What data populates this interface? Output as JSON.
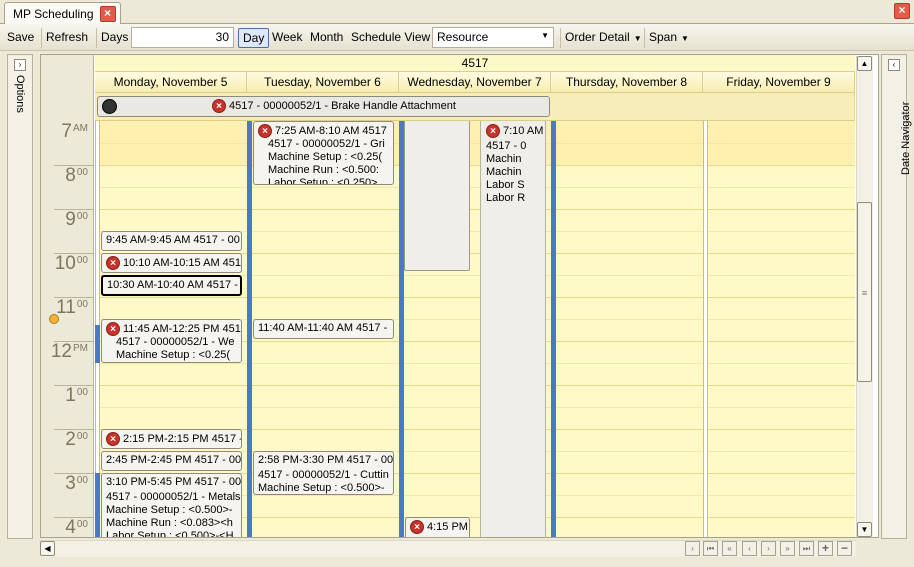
{
  "tab": {
    "title": "MP Scheduling",
    "close_glyph": "×"
  },
  "window_close_glyph": "×",
  "toolbar": {
    "save": "Save",
    "refresh": "Refresh",
    "days_label": "Days",
    "days_value": "30",
    "day": "Day",
    "week": "Week",
    "month": "Month",
    "schedule_view": "Schedule View",
    "resource_value": "Resource",
    "order_detail": "Order Detail",
    "span": "Span"
  },
  "side_left": {
    "label": "Options"
  },
  "side_right": {
    "label": "Date Navigator"
  },
  "calendar": {
    "group": "4517",
    "days": [
      "Monday, November 5",
      "Tuesday, November 6",
      "Wednesday, November 7",
      "Thursday, November 8",
      "Friday, November 9"
    ],
    "allday_event": "4517 - 00000052/1 - Brake Handle Attachment",
    "hours": [
      {
        "h": "7",
        "s": "AM"
      },
      {
        "h": "8",
        "s": "00"
      },
      {
        "h": "9",
        "s": "00"
      },
      {
        "h": "10",
        "s": "00"
      },
      {
        "h": "11",
        "s": "00"
      },
      {
        "h": "12",
        "s": "PM"
      },
      {
        "h": "1",
        "s": "00"
      },
      {
        "h": "2",
        "s": "00"
      },
      {
        "h": "3",
        "s": "00"
      },
      {
        "h": "4",
        "s": "00"
      }
    ],
    "appts": {
      "mon_945": "9:45 AM-9:45 AM 4517 - 00",
      "mon_1010": "10:10 AM-10:15 AM 451",
      "mon_1030": "10:30 AM-10:40 AM 4517 -",
      "mon_1145_a": "11:45 AM-12:25 PM 451",
      "mon_1145_b": "4517 - 00000052/1 - We",
      "mon_1145_c": "Machine Setup : <0.25(",
      "mon_215": "2:15 PM-2:15 PM 4517 -",
      "mon_245": "2:45 PM-2:45 PM 4517 - 00",
      "mon_310_a": "3:10 PM-5:45 PM 4517 - 00",
      "mon_310_b": "4517 - 00000052/1 - Metals",
      "mon_310_c": "Machine Setup : <0.500>-",
      "mon_310_d": "Machine Run : <0.083><h",
      "mon_310_e": "Labor Setup : <0.500>-<H",
      "tue_725_a": "7:25 AM-8:10 AM 4517",
      "tue_725_b": "4517 - 00000052/1 - Gri",
      "tue_725_c": "Machine Setup : <0.25(",
      "tue_725_d": "Machine Run : <0.500:",
      "tue_725_e": "Labor Setup : <0.250>",
      "tue_1140": "11:40 AM-11:40 AM 4517 -",
      "tue_258_a": "2:58 PM-3:30 PM 4517 - 00",
      "tue_258_b": "4517 - 00000052/1 - Cuttin",
      "tue_258_c": "Machine Setup : <0.500>-",
      "wed_415": "4:15 PM",
      "thu_710_a": "7:10 AM",
      "thu_710_b": "4517 - 0",
      "thu_710_c": "Machin",
      "thu_710_d": "Machin",
      "thu_710_e": "Labor S",
      "thu_710_f": "Labor R"
    }
  },
  "colors": {
    "accent": "#4b79c7",
    "error": "#c8342b",
    "grid_bg": "#fff9c8"
  }
}
